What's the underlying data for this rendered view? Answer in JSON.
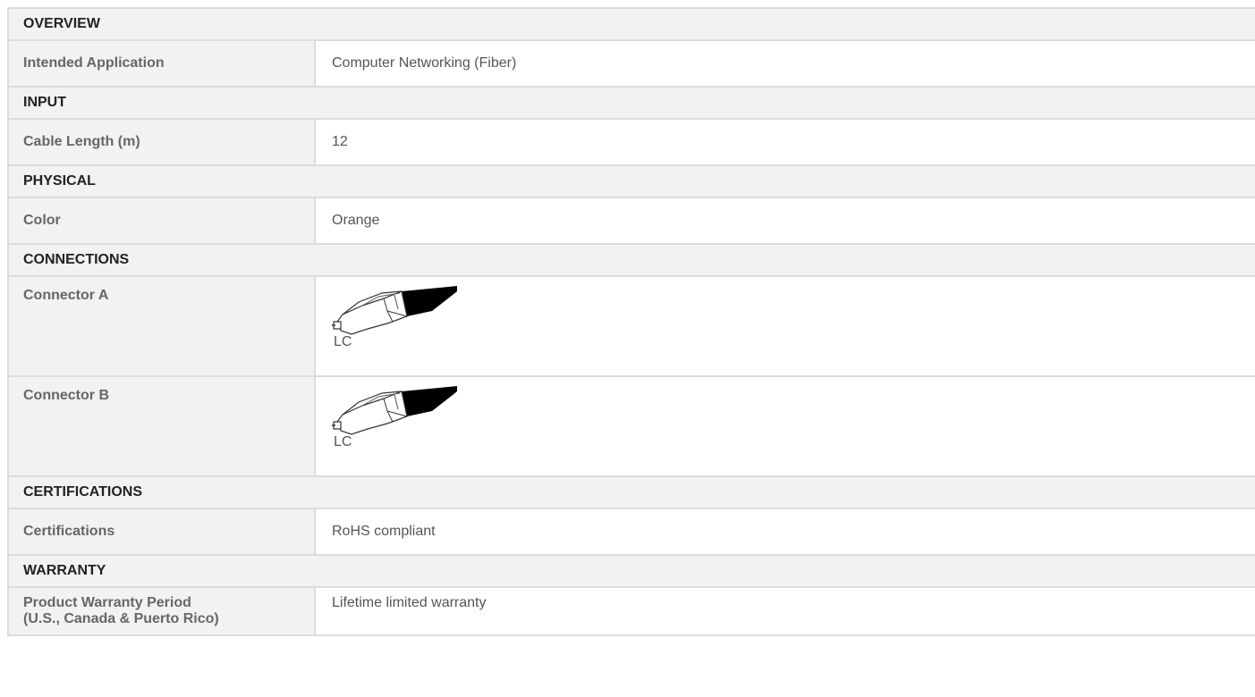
{
  "sections": [
    {
      "title": "OVERVIEW",
      "rows": [
        {
          "label": "Intended Application",
          "value": "Computer Networking (Fiber)"
        }
      ]
    },
    {
      "title": "INPUT",
      "rows": [
        {
          "label": "Cable Length (m)",
          "value": "12"
        }
      ]
    },
    {
      "title": "PHYSICAL",
      "rows": [
        {
          "label": "Color",
          "value": "Orange"
        }
      ]
    },
    {
      "title": "CONNECTIONS",
      "rows": [
        {
          "label": "Connector A",
          "value": "LC",
          "icon": "lc-connector-icon"
        },
        {
          "label": "Connector B",
          "value": "LC",
          "icon": "lc-connector-icon"
        }
      ]
    },
    {
      "title": "CERTIFICATIONS",
      "rows": [
        {
          "label": "Certifications",
          "value": "RoHS compliant"
        }
      ]
    },
    {
      "title": "WARRANTY",
      "rows": [
        {
          "label": "Product Warranty Period\n(U.S., Canada & Puerto Rico)",
          "label_line1": "Product Warranty Period",
          "label_line2": "(U.S., Canada & Puerto Rico)",
          "value": "Lifetime limited warranty"
        }
      ]
    }
  ],
  "colors": {
    "header_bg": "#f2f2f2",
    "border": "#dcdcdc",
    "label_text": "#666666",
    "value_text": "#555555",
    "header_text": "#222222"
  }
}
